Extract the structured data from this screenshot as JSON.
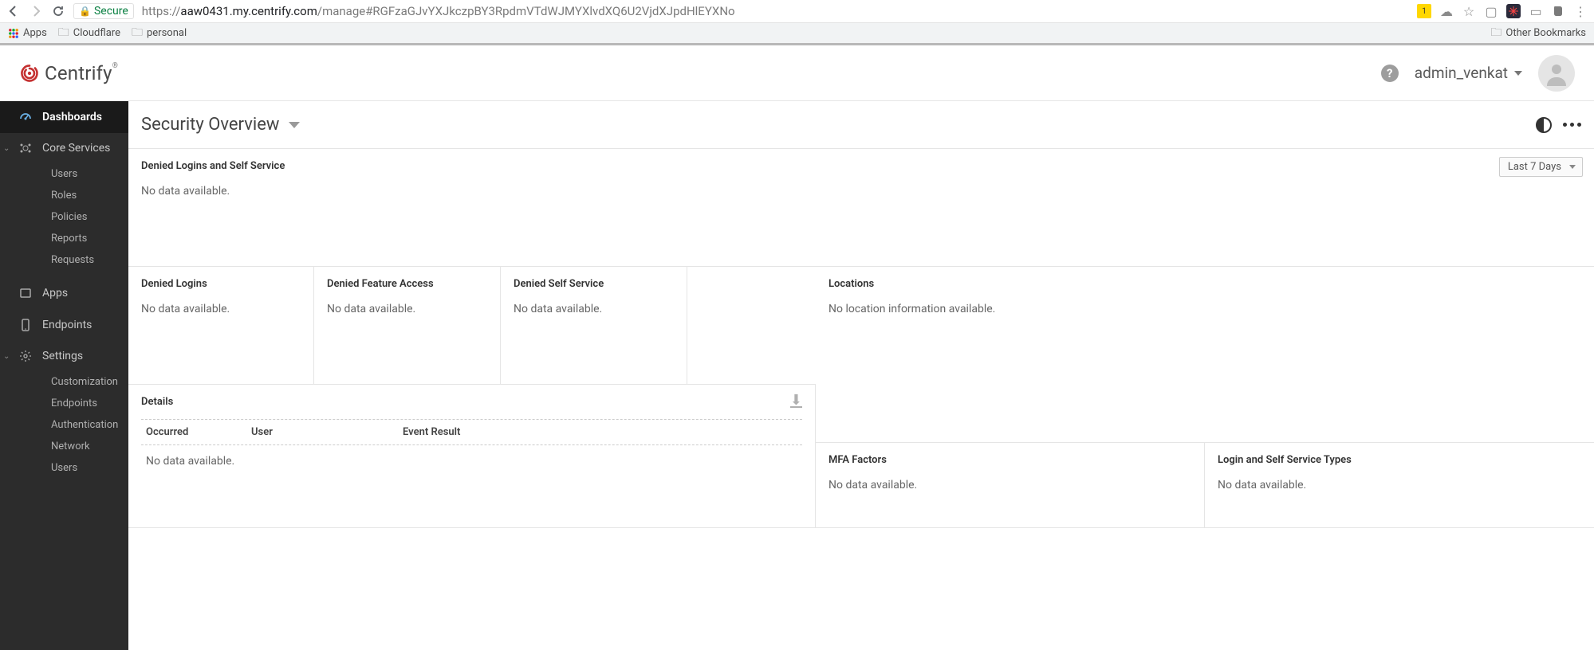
{
  "browser": {
    "secure_label": "Secure",
    "url_scheme": "https://",
    "url_host": "aaw0431.my.centrify.com",
    "url_path": "/manage#RGFzaGJvYXJkczpBY3RpdmVTdWJMYXlvdXQ6U2VjdXJpdHlEYXNo",
    "bookmarks": {
      "apps": "Apps",
      "cloudflare": "Cloudflare",
      "personal": "personal",
      "other": "Other Bookmarks"
    }
  },
  "header": {
    "brand": "Centrify",
    "username": "admin_venkat"
  },
  "sidebar": {
    "dashboards": "Dashboards",
    "core_services": "Core Services",
    "core_items": {
      "users": "Users",
      "roles": "Roles",
      "policies": "Policies",
      "reports": "Reports",
      "requests": "Requests"
    },
    "apps": "Apps",
    "endpoints": "Endpoints",
    "settings": "Settings",
    "settings_items": {
      "customization": "Customization",
      "endpoints": "Endpoints",
      "authentication": "Authentication",
      "network": "Network",
      "users": "Users"
    }
  },
  "page": {
    "title": "Security Overview",
    "time_range": "Last 7 Days",
    "widgets": {
      "denied_logins_self_service": {
        "title": "Denied Logins and Self Service",
        "body": "No data available."
      },
      "denied_logins": {
        "title": "Denied Logins",
        "body": "No data available."
      },
      "denied_feature": {
        "title": "Denied Feature Access",
        "body": "No data available."
      },
      "denied_self_service": {
        "title": "Denied Self Service",
        "body": "No data available."
      },
      "locations": {
        "title": "Locations",
        "body": "No location information available."
      },
      "details": {
        "title": "Details",
        "cols": {
          "occurred": "Occurred",
          "user": "User",
          "event": "Event Result"
        },
        "empty": "No data available."
      },
      "mfa": {
        "title": "MFA Factors",
        "body": "No data available."
      },
      "login_types": {
        "title": "Login and Self Service Types",
        "body": "No data available."
      }
    }
  }
}
